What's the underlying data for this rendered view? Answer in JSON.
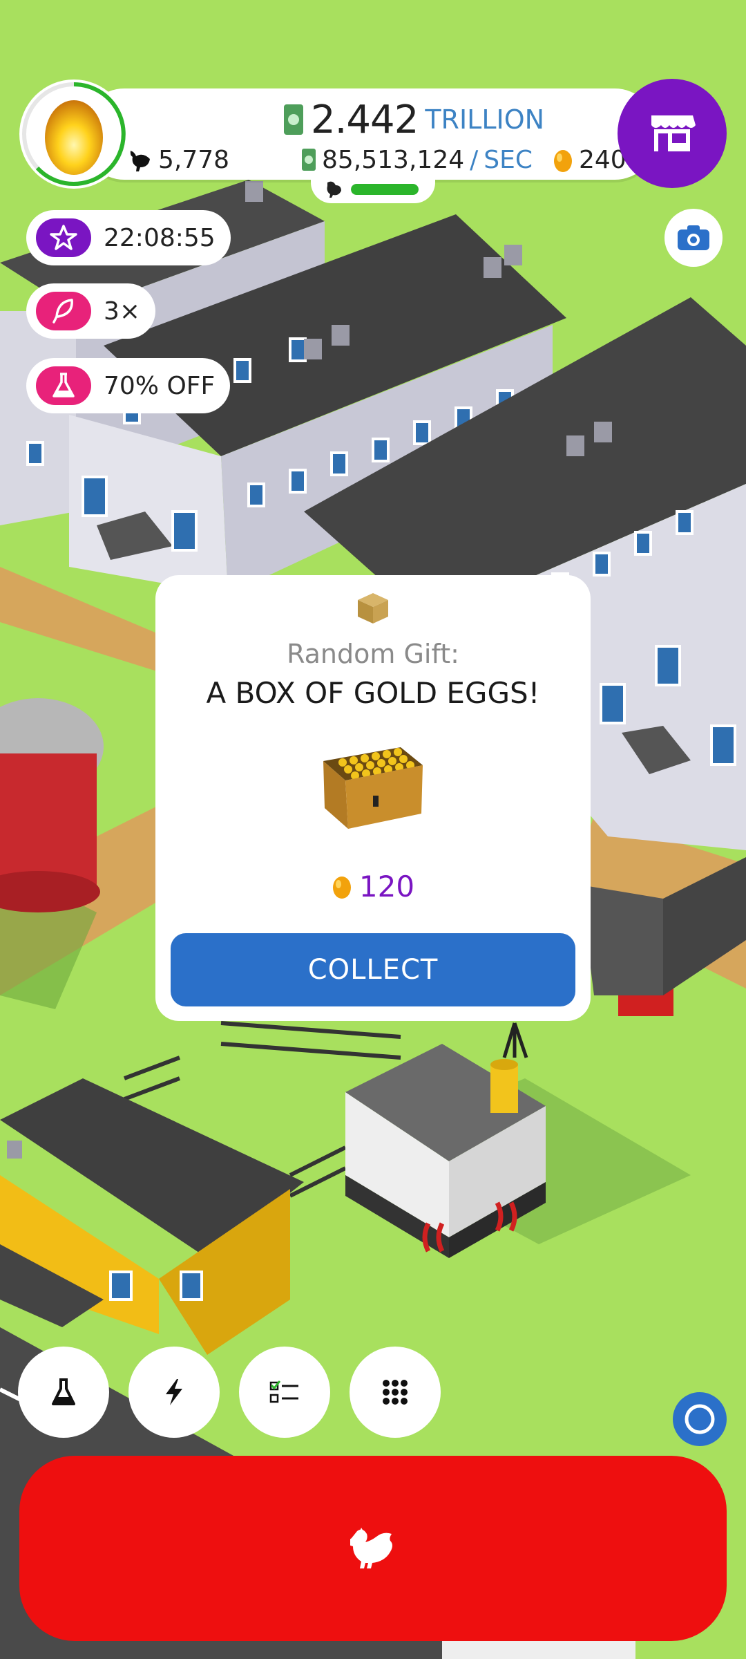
{
  "hud": {
    "money_value": "2.442",
    "money_unit": "TRILLION",
    "rate_value": "85,513,124",
    "rate_slash": "/",
    "rate_unit": "SEC",
    "chickens": "5,778",
    "gold_eggs": "240",
    "hatchery_progress": 1.0
  },
  "boosts": [
    {
      "label": "22:08:55",
      "icon": "star-icon",
      "color": "#7a15c2"
    },
    {
      "label": "3×",
      "icon": "feather-icon",
      "color": "#e8227a"
    },
    {
      "label": "70% OFF",
      "icon": "flask-icon",
      "color": "#e8227a"
    }
  ],
  "dialog": {
    "title_line1": "Random Gift:",
    "title_line2": "A BOX OF GOLD EGGS!",
    "reward_amount": "120",
    "collect_label": "COLLECT"
  },
  "bottom_buttons": [
    {
      "name": "research-button",
      "icon": "flask-icon"
    },
    {
      "name": "boost-button",
      "icon": "lightning-icon"
    },
    {
      "name": "missions-button",
      "icon": "checklist-icon"
    },
    {
      "name": "menu-button",
      "icon": "grid-icon"
    }
  ],
  "colors": {
    "grass": "#a8e05e",
    "purple": "#7a15c2",
    "pink": "#e8227a",
    "blue": "#2b70c9",
    "red": "#ee0f0f"
  }
}
